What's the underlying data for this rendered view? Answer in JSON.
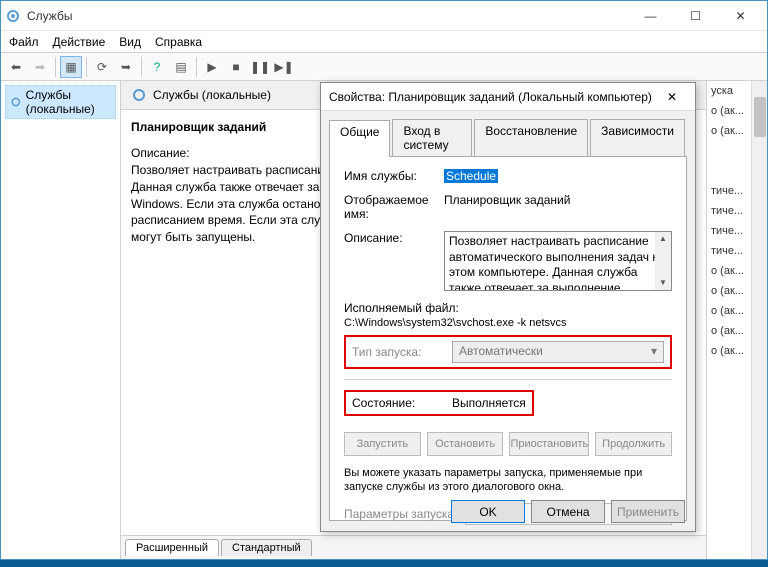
{
  "window": {
    "title": "Службы",
    "menu": {
      "file": "Файл",
      "action": "Действие",
      "view": "Вид",
      "help": "Справка"
    },
    "controls": {
      "min": "—",
      "max": "☐",
      "close": "✕"
    }
  },
  "tree": {
    "root": "Службы (локальные)"
  },
  "detail": {
    "header": "Службы (локальные)",
    "service_name": "Планировщик заданий",
    "desc_label": "Описание:",
    "desc_text": "Позволяет настраивать расписание автоматического выполнения задач на этом компьютере. Данная служба также отвечает за выполнение нескольких критически важных системных задач Windows. Если эта служба остановлена, эти задачи не могут быть запущены в установленное расписанием время. Если эта служба отключена, любые службы, которые явно зависят от нее, не могут быть запущены.",
    "tabs": {
      "extended": "Расширенный",
      "standard": "Стандартный"
    }
  },
  "right_list": [
    "уска",
    "о (ак...",
    "о (ак...",
    "тиче...",
    "тиче...",
    "тиче...",
    "тиче...",
    "о (ак...",
    "о (ак...",
    "о (ак...",
    "о (ак...",
    "о (ак..."
  ],
  "dialog": {
    "title": "Свойства: Планировщик заданий (Локальный компьютер)",
    "tabs": {
      "general": "Общие",
      "logon": "Вход в систему",
      "recovery": "Восстановление",
      "deps": "Зависимости"
    },
    "fields": {
      "svc_name_label": "Имя службы:",
      "svc_name_value": "Schedule",
      "display_label": "Отображаемое имя:",
      "display_value": "Планировщик заданий",
      "desc_label": "Описание:",
      "desc_value": "Позволяет настраивать расписание автоматического выполнения задач на этом компьютере. Данная служба также отвечает за выполнение нескольких критически важных",
      "exec_label": "Исполняемый файл:",
      "exec_path": "C:\\Windows\\system32\\svchost.exe -k netsvcs",
      "startup_label": "Тип запуска:",
      "startup_value": "Автоматически",
      "state_label": "Состояние:",
      "state_value": "Выполняется",
      "note": "Вы можете указать параметры запуска, применяемые при запуске службы из этого диалогового окна.",
      "params_label": "Параметры запуска:"
    },
    "ctrl": {
      "start": "Запустить",
      "stop": "Остановить",
      "pause": "Приостановить",
      "resume": "Продолжить"
    },
    "buttons": {
      "ok": "OK",
      "cancel": "Отмена",
      "apply": "Применить"
    }
  }
}
